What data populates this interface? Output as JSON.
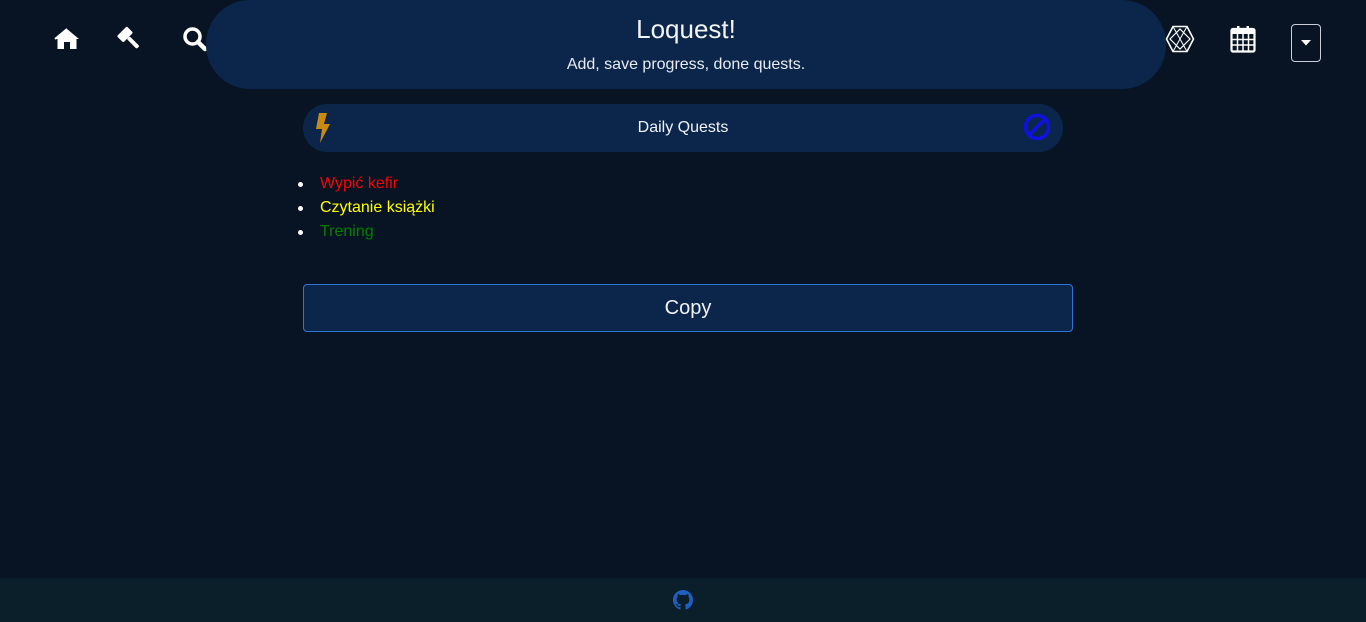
{
  "app": {
    "title": "Loquest!",
    "subtitle": "Add, save progress, done quests."
  },
  "nav": {
    "left_icons": [
      "home-icon",
      "gavel-icon",
      "search-icon"
    ],
    "right_icons": [
      "hexagon-icon",
      "calendar-icon"
    ],
    "dropdown_icon": "caret-down-icon"
  },
  "section": {
    "title": "Daily Quests",
    "left_icon": "bolt-icon",
    "right_icon": "block-icon"
  },
  "quests": [
    {
      "label": "Wypić kefir",
      "color": "#ff0000"
    },
    {
      "label": "Czytanie książki",
      "color": "#ffff00"
    },
    {
      "label": "Trening",
      "color": "#008000"
    }
  ],
  "actions": {
    "copy_label": "Copy"
  },
  "footer": {
    "icon": "github-icon"
  },
  "colors": {
    "background": "#081424",
    "panel": "#0b264a",
    "accent_border": "#2f76d8",
    "bolt": "#c98a12",
    "block": "#1010e0",
    "footer": "#0a1f29"
  }
}
